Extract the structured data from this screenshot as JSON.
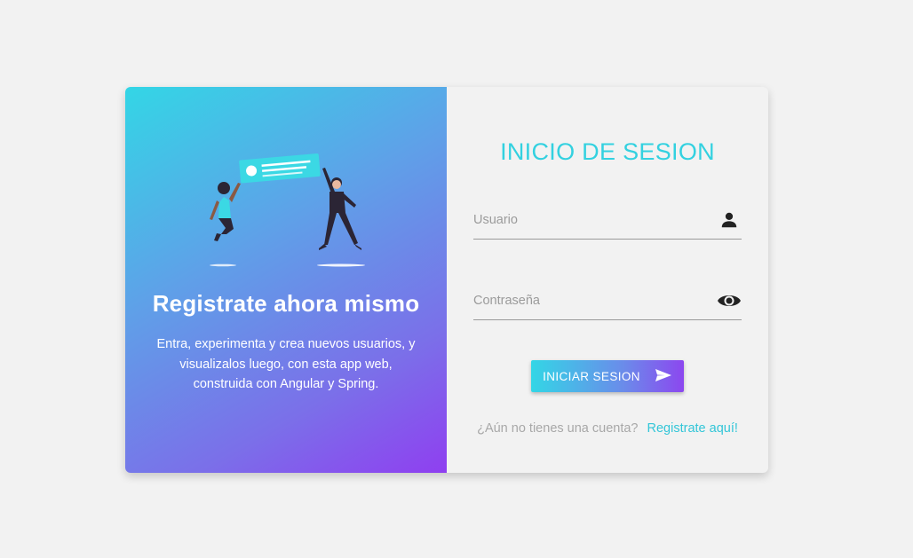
{
  "promo": {
    "title": "Registrate ahora mismo",
    "text": "Entra, experimenta y crea nuevos usuarios, y visualizalos luego, con esta app web, construida con Angular y Spring."
  },
  "login": {
    "title": "INICIO DE SESION",
    "username": {
      "placeholder": "Usuario",
      "value": "",
      "icon": "person-icon"
    },
    "password": {
      "placeholder": "Contraseña",
      "value": "",
      "icon": "eye-icon"
    },
    "submit_label": "INICIAR SESION",
    "submit_icon": "send-icon",
    "register_question": "¿Aún no tienes una cuenta?",
    "register_link": "Registrate aquí!"
  },
  "colors": {
    "accent": "#33d1e0",
    "gradient_start": "#33d6e6",
    "gradient_end": "#8f3ff0",
    "background": "#f2f2f2"
  }
}
